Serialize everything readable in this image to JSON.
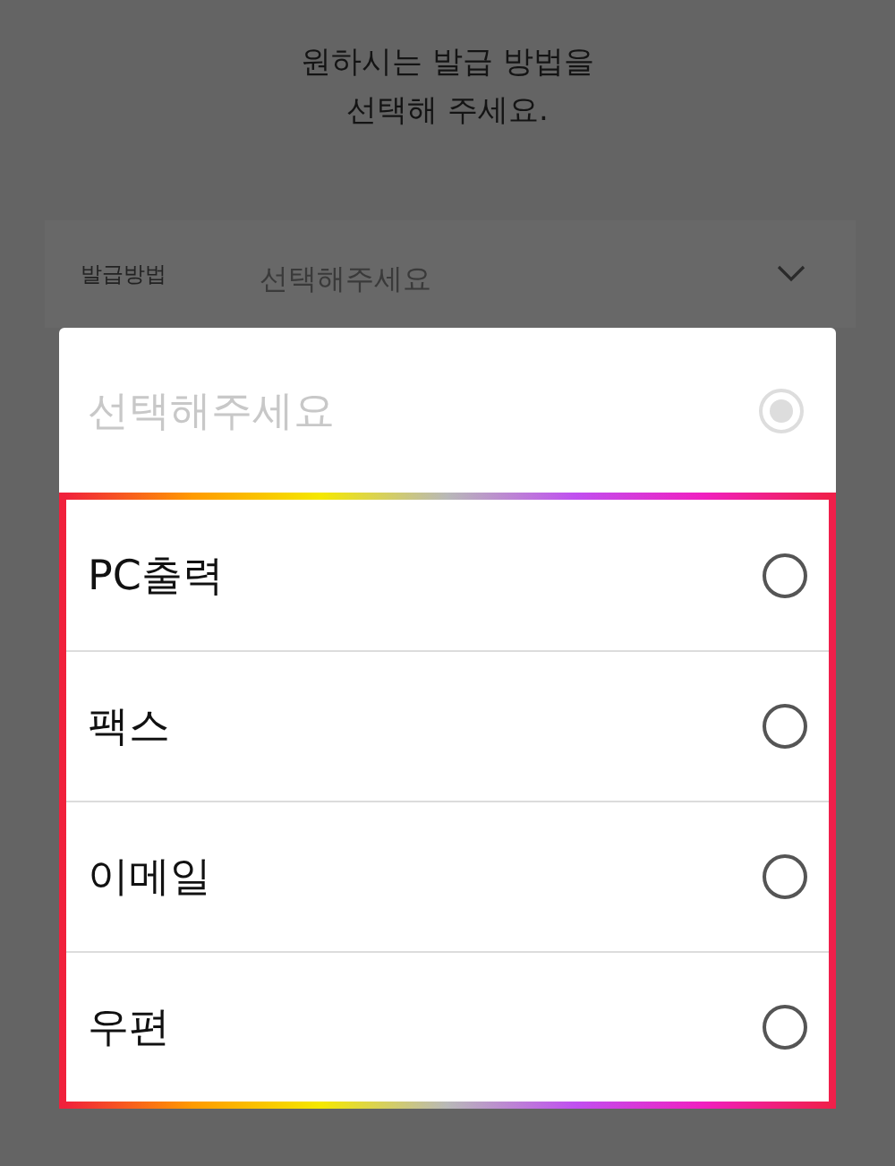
{
  "heading": [
    "원하시는 발급 방법을",
    "선택해 주세요."
  ],
  "field": {
    "label": "발급방법",
    "placeholder": "선택해주세요"
  },
  "dialog": {
    "options": [
      {
        "label": "선택해주세요",
        "selected": true,
        "disabled": true
      },
      {
        "label": "PC출력",
        "selected": false,
        "disabled": false
      },
      {
        "label": "팩스",
        "selected": false,
        "disabled": false
      },
      {
        "label": "이메일",
        "selected": false,
        "disabled": false
      },
      {
        "label": "우편",
        "selected": false,
        "disabled": false
      }
    ]
  }
}
